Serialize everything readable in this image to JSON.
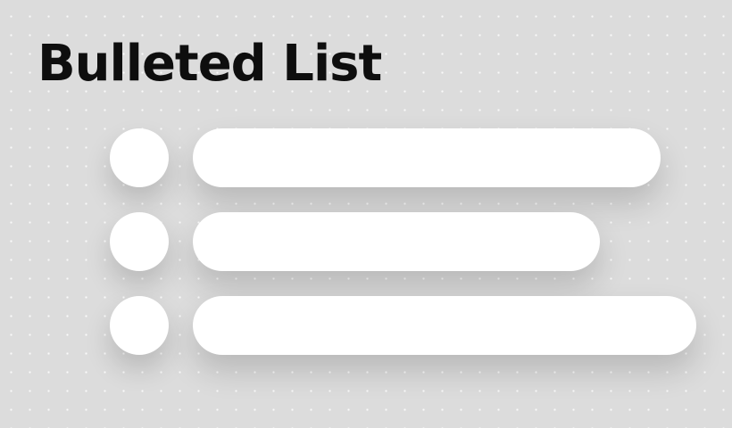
{
  "header": {
    "title": "Bulleted List"
  },
  "list": {
    "item_count": 3,
    "items": [
      {
        "bullet_icon": "circle-bullet-icon",
        "text": ""
      },
      {
        "bullet_icon": "circle-bullet-icon",
        "text": ""
      },
      {
        "bullet_icon": "circle-bullet-icon",
        "text": ""
      }
    ]
  },
  "colors": {
    "background": "#dcdcdc",
    "dot_grid": "#ffffff",
    "title_text": "#0e0e0e",
    "list_shapes": "#ffffff"
  }
}
